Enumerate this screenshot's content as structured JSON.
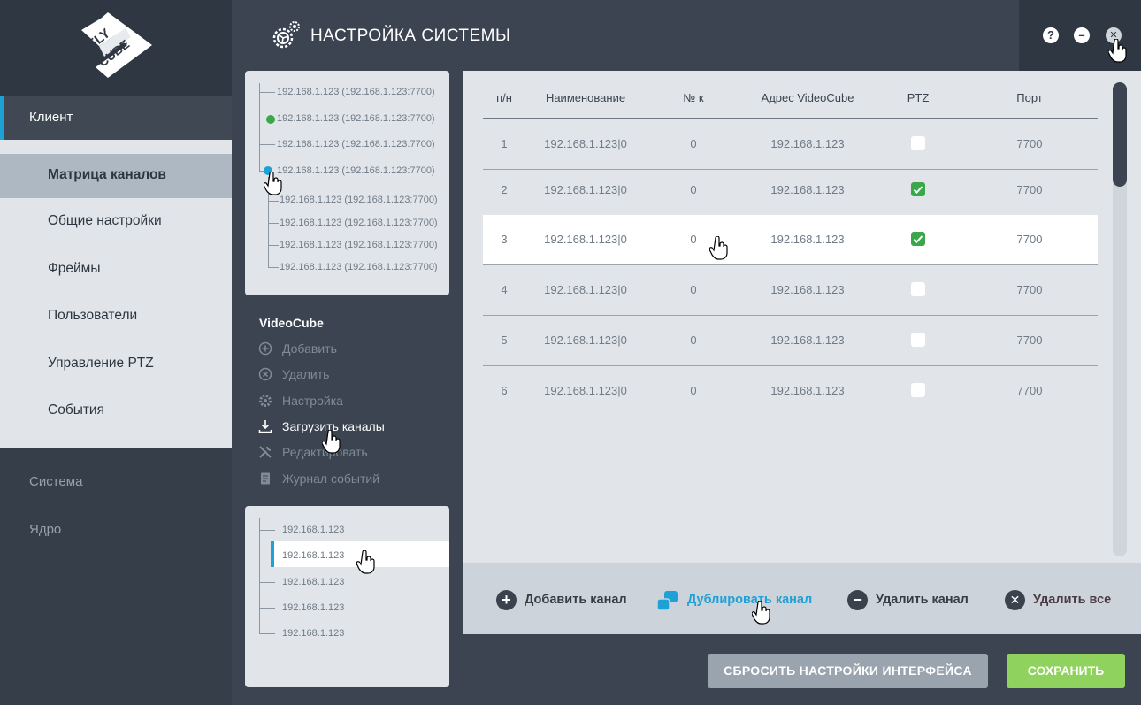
{
  "app": {
    "logo_text": "FLY CUBE",
    "title": "НАСТРОЙКА СИСТЕМЫ"
  },
  "window_controls": {
    "help": "?",
    "minimize": "–",
    "close": "✕"
  },
  "sidebar": {
    "client_label": "Клиент",
    "client_items": [
      {
        "label": "Матрица каналов",
        "active": true
      },
      {
        "label": "Общие настройки"
      },
      {
        "label": "Фреймы"
      },
      {
        "label": "Пользователи"
      },
      {
        "label": "Управление PTZ"
      },
      {
        "label": "События"
      }
    ],
    "system_label": "Система",
    "core_label": "Ядро"
  },
  "server_tree": {
    "items": [
      "192.168.1.123 (192.168.1.123:7700)",
      "192.168.1.123 (192.168.1.123:7700)",
      "192.168.1.123 (192.168.1.123:7700)",
      "192.168.1.123 (192.168.1.123:7700)",
      "192.168.1.123 (192.168.1.123:7700)",
      "192.168.1.123 (192.168.1.123:7700)",
      "192.168.1.123 (192.168.1.123:7700)",
      "192.168.1.123 (192.168.1.123:7700)"
    ]
  },
  "videocube": {
    "title": "VideoCube",
    "actions": [
      {
        "label": "Добавить",
        "icon": "plus-circle-icon"
      },
      {
        "label": "Удалить",
        "icon": "x-circle-icon"
      },
      {
        "label": "Настройка",
        "icon": "gear-icon"
      },
      {
        "label": "Загрузить каналы",
        "icon": "download-icon"
      },
      {
        "label": "Редактировать",
        "icon": "wrench-icon"
      },
      {
        "label": "Журнал событий",
        "icon": "log-icon"
      }
    ]
  },
  "ip_list": {
    "items": [
      "192.168.1.123",
      "192.168.1.123",
      "192.168.1.123",
      "192.168.1.123",
      "192.168.1.123"
    ]
  },
  "table": {
    "headers": [
      "п/н",
      "Наименование",
      "№ к",
      "Адрес VideoCube",
      "PTZ",
      "Порт"
    ],
    "rows": [
      {
        "n": "1",
        "name": "192.168.1.123|0",
        "k": "0",
        "addr": "192.168.1.123",
        "ptz": false,
        "port": "7700"
      },
      {
        "n": "2",
        "name": "192.168.1.123|0",
        "k": "0",
        "addr": "192.168.1.123",
        "ptz": true,
        "port": "7700"
      },
      {
        "n": "3",
        "name": "192.168.1.123|0",
        "k": "0",
        "addr": "192.168.1.123",
        "ptz": true,
        "port": "7700"
      },
      {
        "n": "4",
        "name": "192.168.1.123|0",
        "k": "0",
        "addr": "192.168.1.123",
        "ptz": false,
        "port": "7700"
      },
      {
        "n": "5",
        "name": "192.168.1.123|0",
        "k": "0",
        "addr": "192.168.1.123",
        "ptz": false,
        "port": "7700"
      },
      {
        "n": "6",
        "name": "192.168.1.123|0",
        "k": "0",
        "addr": "192.168.1.123",
        "ptz": false,
        "port": "7700"
      }
    ]
  },
  "channel_actions": {
    "add": "Добавить канал",
    "duplicate": "Дублировать канал",
    "remove": "Удалить канал",
    "remove_all": "Удалить все"
  },
  "footer": {
    "reset": "СБРОСИТЬ НАСТРОЙКИ ИНТЕРФЕЙСА",
    "save": "СОХРАНИТЬ"
  },
  "colors": {
    "accent": "#1ea1d6",
    "save": "#8fd25d",
    "check_on": "#3aa84a",
    "tree_dot_green": "#3aa84a"
  }
}
